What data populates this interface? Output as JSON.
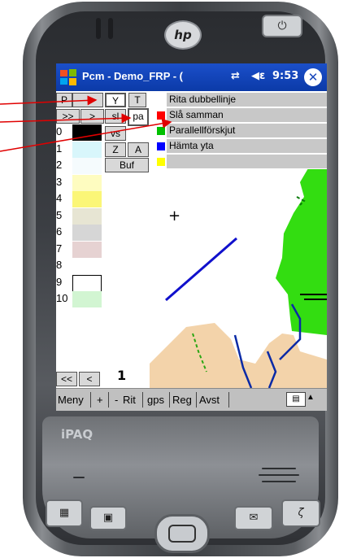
{
  "device": {
    "brand": "iPAQ",
    "logo_text": "hp",
    "power_glyph": "⏻",
    "buttons": {
      "calendar_icon": "calendar-icon",
      "contacts_icon": "contacts-icon",
      "mail_icon": "mail-icon",
      "phone_icon": "phone-icon"
    }
  },
  "titlebar": {
    "app_title": "Pcm - Demo_FRP - (",
    "time": "9:53",
    "sync_icon": "⇄",
    "volume_icon": "◀ε",
    "close_label": "✕",
    "accent": "#1846bb"
  },
  "toolbar": {
    "p_label": "P",
    "y_label": "Y",
    "t_label": "T",
    "next_label": ">>",
    "fwd_label": ">",
    "sl_label": "sl",
    "pa_label": "pa",
    "vs_label": "vs",
    "z_label": "Z",
    "a_label": "A",
    "buf_label": "Buf",
    "back_label": "<<",
    "prev_label": "<"
  },
  "layers": [
    {
      "label": "Rita dubbellinje",
      "color": "#ffffff"
    },
    {
      "label": "Slå samman",
      "color": "#ff0000"
    },
    {
      "label": "Parallellförskjut",
      "color": "#00c000"
    },
    {
      "label": "Hämta yta",
      "color": "#0000ff"
    },
    {
      "label": "",
      "color": "#ffff00"
    }
  ],
  "rows": [
    {
      "num": "0",
      "color": "#000000"
    },
    {
      "num": "1",
      "color": "#d8f6fb"
    },
    {
      "num": "2",
      "color": "#f5fbfd"
    },
    {
      "num": "3",
      "color": "#fefcc0"
    },
    {
      "num": "4",
      "color": "#fbf677"
    },
    {
      "num": "5",
      "color": "#e7e5d3"
    },
    {
      "num": "6",
      "color": "#d6d6d6"
    },
    {
      "num": "7",
      "color": "#e6d2d2"
    },
    {
      "num": "8",
      "color": "#ffffff"
    },
    {
      "num": "9",
      "color": "#ffffff"
    },
    {
      "num": "10",
      "color": "#d2f5d2"
    }
  ],
  "map": {
    "scale_label": "1",
    "cursor": "+",
    "green_area": "#33dd11",
    "sand_area": "#f3d3aa"
  },
  "menubar": {
    "items": [
      "Meny",
      "+",
      "-",
      "Rit",
      "gps",
      "Reg",
      "Avst"
    ],
    "kbd_icon": "▤",
    "up_icon": "▲"
  }
}
